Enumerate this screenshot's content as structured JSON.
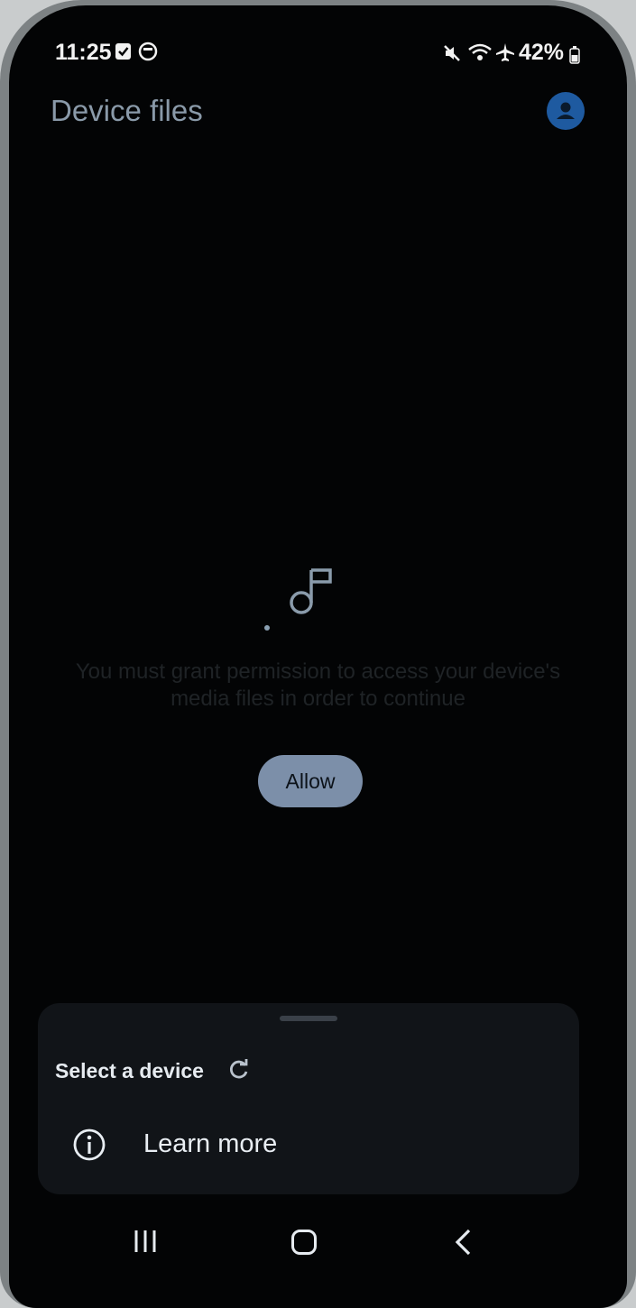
{
  "status_bar": {
    "time": "11:25",
    "battery": "42%"
  },
  "header": {
    "title": "Device files"
  },
  "permission": {
    "message": "You must grant permission to access your device's media files in order to continue",
    "allow_label": "Allow"
  },
  "bottom_sheet": {
    "select_device_label": "Select a device",
    "learn_more_label": "Learn more"
  },
  "icons": {
    "status": [
      "checkbox-icon",
      "media-icon",
      "mute-icon",
      "wifi-icon",
      "airplane-icon",
      "battery-icon"
    ],
    "center": "music-note-icon",
    "nav": [
      "recent-apps-icon",
      "home-icon",
      "back-icon"
    ]
  },
  "colors": {
    "accent": "#7c8fa9",
    "avatar": "#1e5aa0",
    "title": "#8a9aa9"
  }
}
